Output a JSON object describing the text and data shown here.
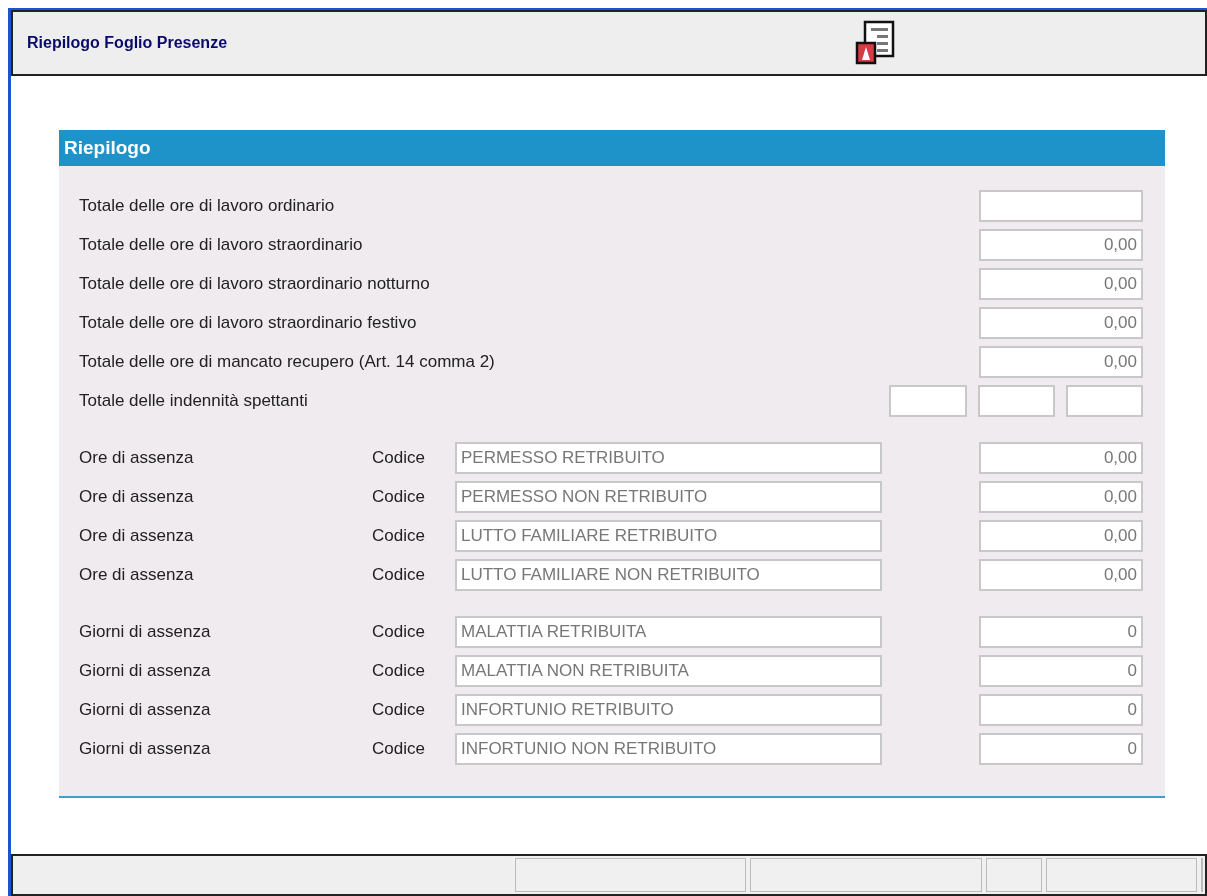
{
  "header": {
    "title": "Riepilogo Foglio Presenze"
  },
  "panel": {
    "title": "Riepilogo",
    "totals": [
      {
        "kind": "single",
        "label": "Totale delle ore di lavoro ordinario"
      },
      {
        "kind": "single",
        "label": "Totale delle ore di lavoro straordinario",
        "value": "0,00"
      },
      {
        "kind": "single",
        "label": "Totale delle ore di lavoro straordinario notturno",
        "value": "0,00"
      },
      {
        "kind": "single",
        "label": "Totale delle ore di lavoro straordinario festivo",
        "value": "0,00"
      },
      {
        "kind": "single",
        "label": "Totale delle ore di mancato recupero (Art. 14 comma 2)",
        "value": "0,00"
      },
      {
        "kind": "triple",
        "label": "Totale delle indennità spettanti"
      }
    ],
    "absence_groups": [
      [
        {
          "label": "Ore di assenza",
          "code_label": "Codice",
          "code": "PERMESSO RETRIBUITO",
          "value": "0,00"
        },
        {
          "label": "Ore di assenza",
          "code_label": "Codice",
          "code": "PERMESSO NON RETRIBUITO",
          "value": "0,00"
        },
        {
          "label": "Ore di assenza",
          "code_label": "Codice",
          "code": "LUTTO FAMILIARE RETRIBUITO",
          "value": "0,00"
        },
        {
          "label": "Ore di assenza",
          "code_label": "Codice",
          "code": "LUTTO FAMILIARE NON RETRIBUITO",
          "value": "0,00"
        }
      ],
      [
        {
          "label": "Giorni di assenza",
          "code_label": "Codice",
          "code": "MALATTIA RETRIBUITA",
          "value": "0"
        },
        {
          "label": "Giorni di assenza",
          "code_label": "Codice",
          "code": "MALATTIA NON RETRIBUITA",
          "value": "0"
        },
        {
          "label": "Giorni di assenza",
          "code_label": "Codice",
          "code": "INFORTUNIO RETRIBUITO",
          "value": "0"
        },
        {
          "label": "Giorni di assenza",
          "code_label": "Codice",
          "code": "INFORTUNIO NON RETRIBUITO",
          "value": "0"
        }
      ]
    ]
  }
}
